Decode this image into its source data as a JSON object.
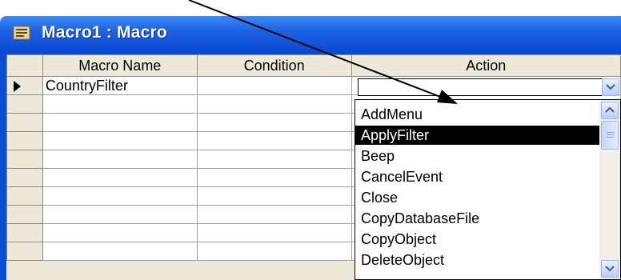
{
  "window": {
    "title": "Macro1 : Macro"
  },
  "grid": {
    "columns": [
      "Macro Name",
      "Condition",
      "Action"
    ],
    "rows": [
      {
        "macro_name": "CountryFilter",
        "condition": "",
        "action": ""
      }
    ],
    "selected_row_indicator": "row-selector-arrow"
  },
  "dropdown": {
    "options": [
      "AddMenu",
      "ApplyFilter",
      "Beep",
      "CancelEvent",
      "Close",
      "CopyDatabaseFile",
      "CopyObject",
      "DeleteObject"
    ],
    "highlighted": "ApplyFilter"
  },
  "colors": {
    "titlebar": "#0b4ad3",
    "highlight": "#000000",
    "grid_header": "#ece9d8",
    "annotation_arrow": "#000000"
  }
}
